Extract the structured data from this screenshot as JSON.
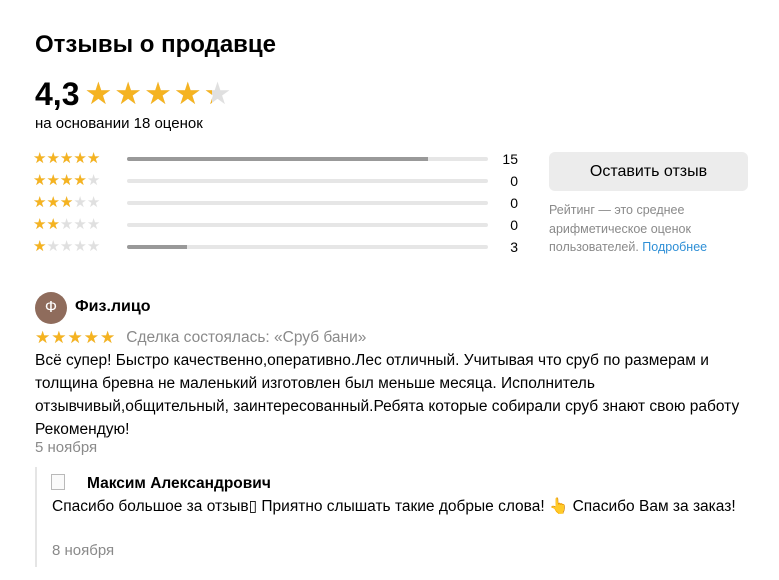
{
  "header": {
    "title": "Отзывы о продавце"
  },
  "summary": {
    "rating_text": "4,3",
    "rating_value": 4.3,
    "max_stars": 5,
    "based_on": "на основании 18 оценок"
  },
  "distribution": [
    {
      "stars": 5,
      "count": 15,
      "count_text": "15",
      "fraction": 0.833
    },
    {
      "stars": 4,
      "count": 0,
      "count_text": "0",
      "fraction": 0
    },
    {
      "stars": 3,
      "count": 0,
      "count_text": "0",
      "fraction": 0
    },
    {
      "stars": 2,
      "count": 0,
      "count_text": "0",
      "fraction": 0
    },
    {
      "stars": 1,
      "count": 3,
      "count_text": "3",
      "fraction": 0.167
    }
  ],
  "actions": {
    "leave_review_label": "Оставить отзыв"
  },
  "rating_note": {
    "text": "Рейтинг — это среднее арифметическое оценок пользователей.",
    "link": "Подробнее"
  },
  "reviews": [
    {
      "avatar_letter": "Ф",
      "author": "Физ.лицо",
      "stars": 5,
      "deal": "Сделка состоялась: «Сруб бани»",
      "text": "Всё супер! Быстро качественно,оперативно.Лес отличный. Учитывая что сруб по размерам и толщина бревна не маленький изготовлен был меньше месяца. Исполнитель отзывчивый,общительный, заинтересованный.Ребята которые собирали сруб знают свою работу Рекомендую!",
      "date": "5 ноября",
      "reply": {
        "author": "Максим Александрович",
        "text": "Спасибо большое за отзыв▯ Приятно слышать такие добрые слова! 👆 Спасибо Вам за заказ!",
        "date": "8 ноября"
      }
    }
  ],
  "colors": {
    "star_filled": "#f5b321",
    "star_empty": "#e0e0e0",
    "bar_fill": "#999999",
    "bar_track": "#e6e6e6",
    "link": "#2e8fd6",
    "muted_text": "#8a8a8a",
    "avatar_bg": "#8f6c5c"
  },
  "icons": {
    "star": "star-icon",
    "reply_avatar": "broken-image-icon"
  }
}
